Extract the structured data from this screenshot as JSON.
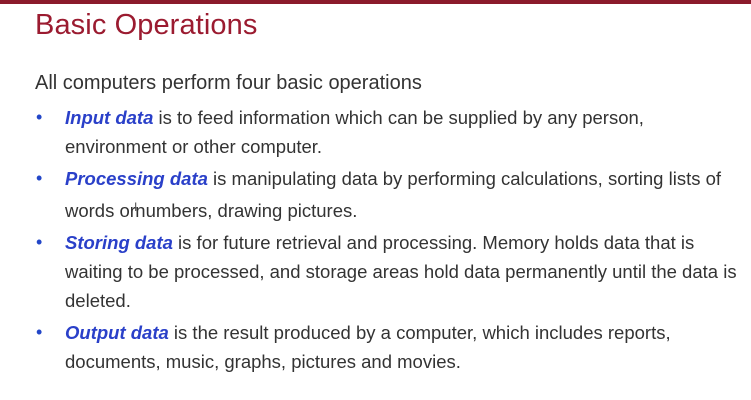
{
  "slide": {
    "title": "Basic Operations",
    "intro": "All computers perform four basic operations",
    "colors": {
      "title": "#9b1b30",
      "rule": "#8b1a2b",
      "term": "#2a40c9",
      "bullet": "#2246c8",
      "body_text": "#333333"
    },
    "bullets": [
      {
        "term": "Input data",
        "text": " is to feed information which can be supplied by any person, environment or other computer."
      },
      {
        "term": "Processing data",
        "text_before_cursor": " is manipulating data by performing calculations, sorting lists of words or",
        "text_after_cursor": "numbers, drawing pictures."
      },
      {
        "term": "Storing data",
        "text": " is for future retrieval and processing. Memory holds data that is waiting to be processed, and storage areas hold data permanently until the data is deleted."
      },
      {
        "term": "Output data",
        "text": " is the result produced by a computer, which includes reports, documents, music, graphs, pictures and movies."
      }
    ],
    "bullet_glyph": "•",
    "cursor_glyph": "I"
  }
}
